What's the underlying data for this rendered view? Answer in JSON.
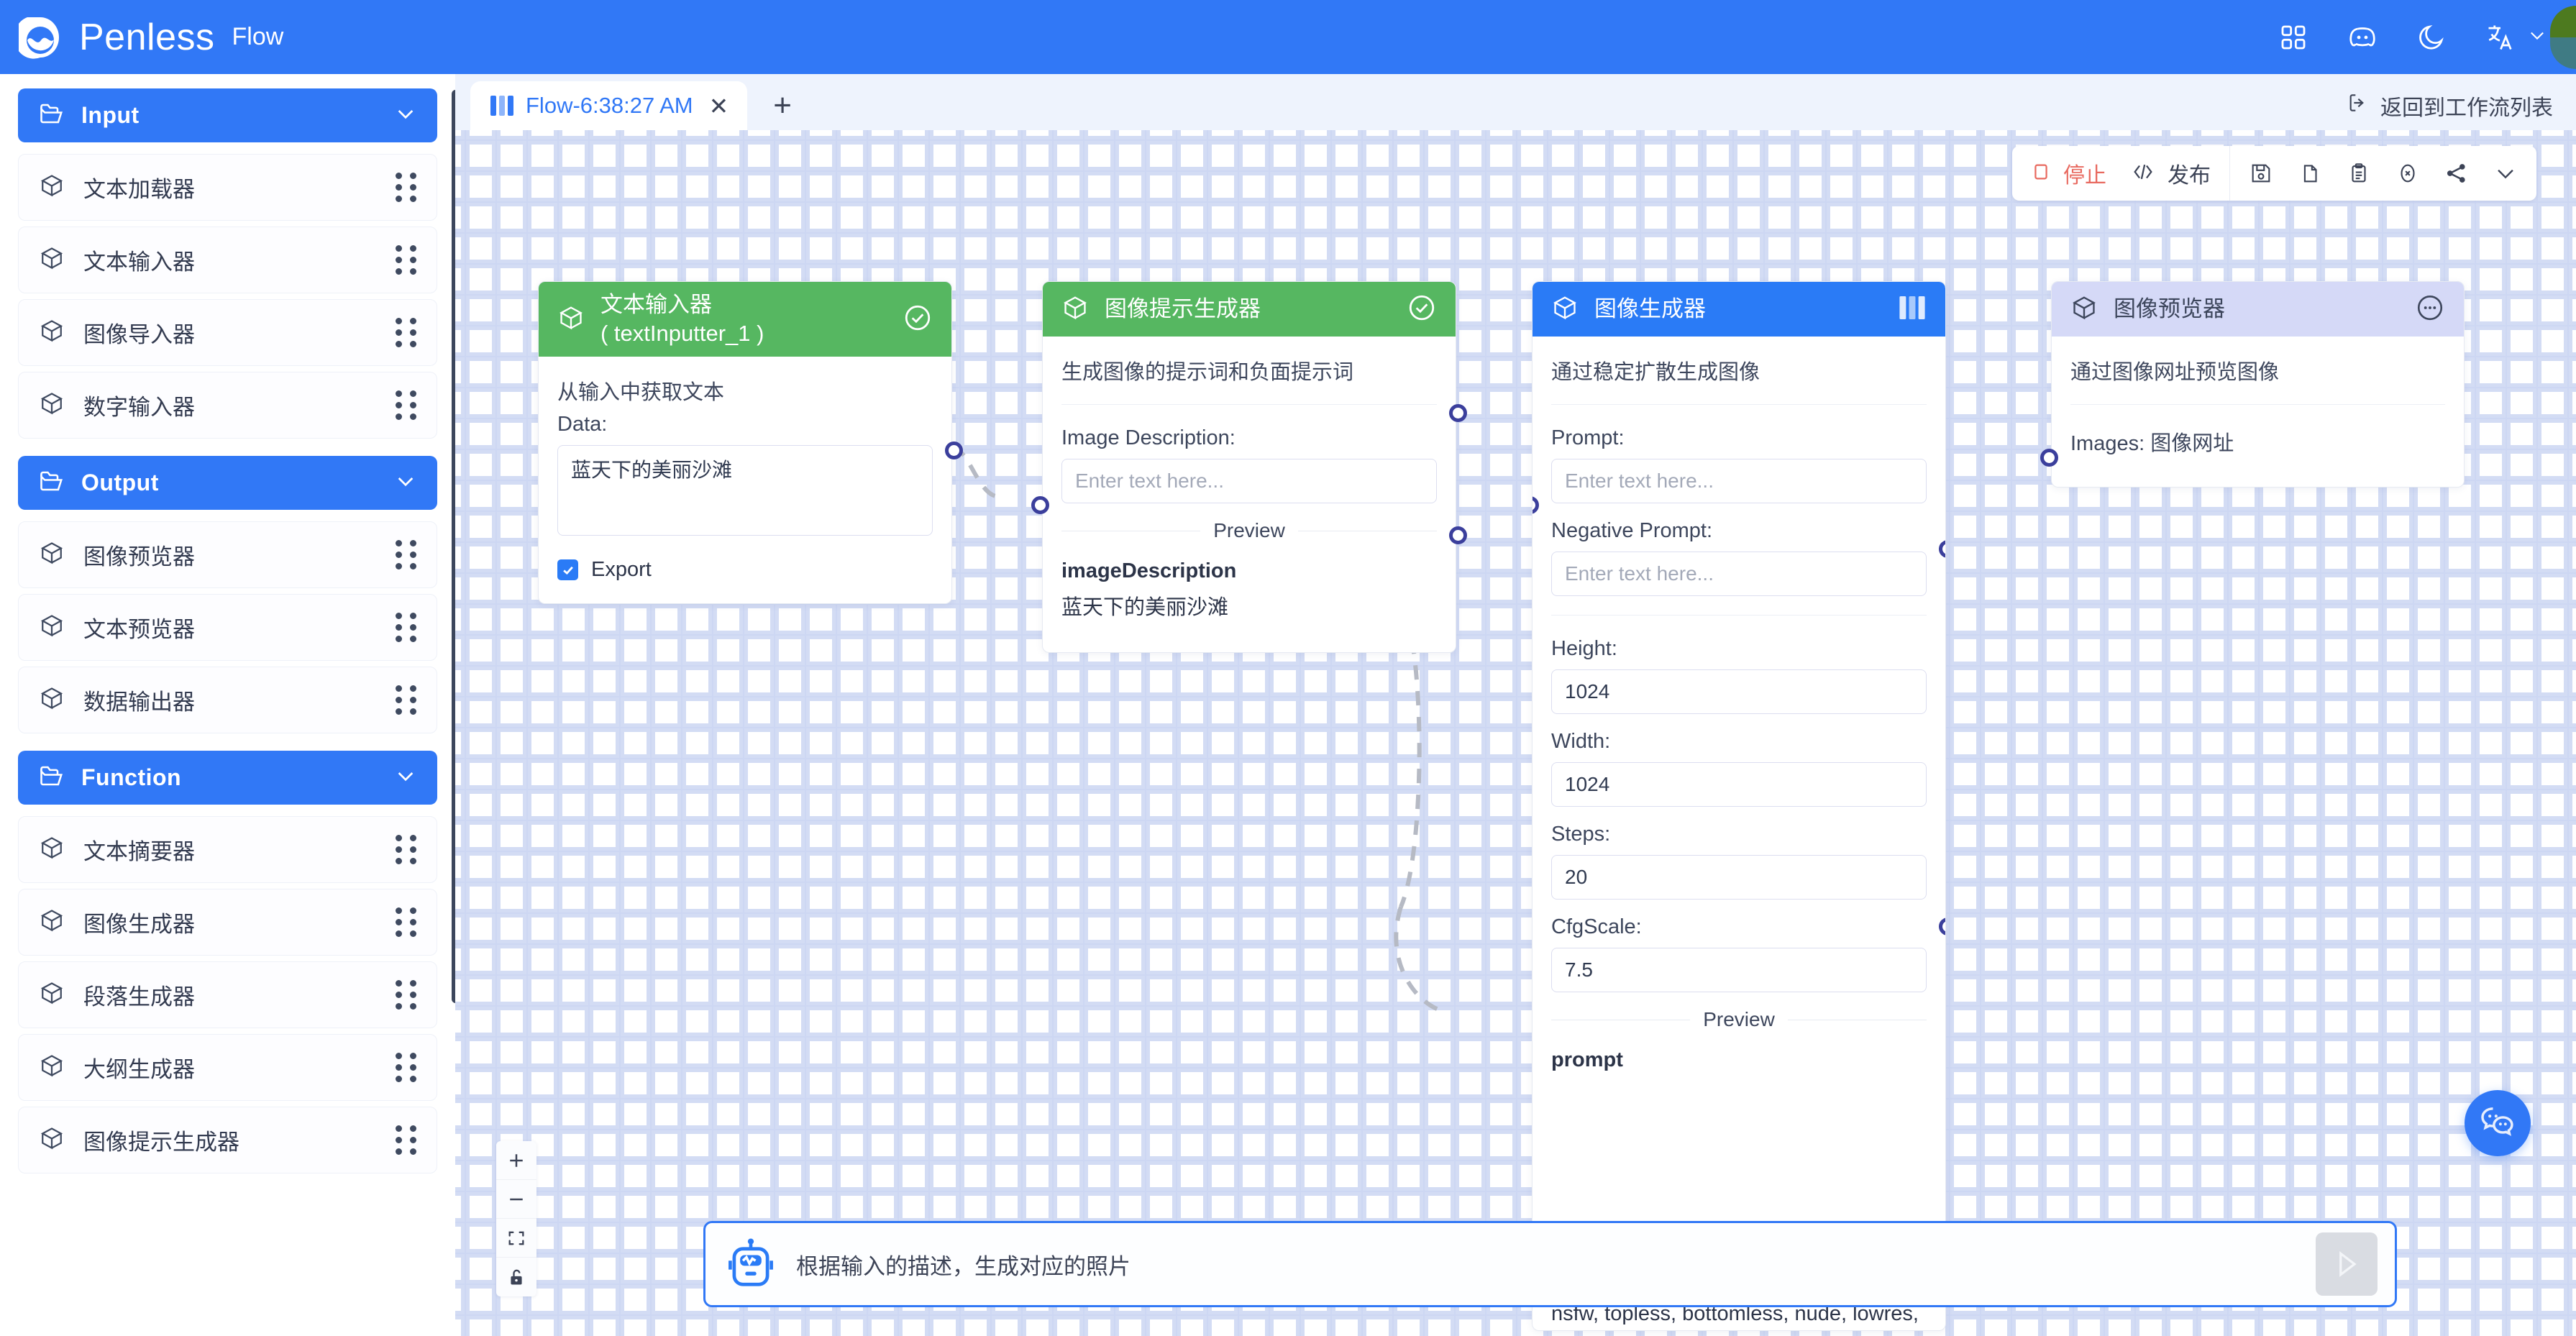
{
  "topbar": {
    "brand": "Penless",
    "product": "Flow",
    "icons": [
      "apps-grid-icon",
      "discord-icon",
      "moon-icon",
      "translate-icon",
      "chevron-down-icon"
    ]
  },
  "sidebar": {
    "groups": [
      {
        "label": "Input",
        "items": [
          {
            "label": "文本加载器"
          },
          {
            "label": "文本输入器"
          },
          {
            "label": "图像导入器"
          },
          {
            "label": "数字输入器"
          }
        ]
      },
      {
        "label": "Output",
        "items": [
          {
            "label": "图像预览器"
          },
          {
            "label": "文本预览器"
          },
          {
            "label": "数据输出器"
          }
        ]
      },
      {
        "label": "Function",
        "items": [
          {
            "label": "文本摘要器"
          },
          {
            "label": "图像生成器"
          },
          {
            "label": "段落生成器"
          },
          {
            "label": "大纲生成器"
          },
          {
            "label": "图像提示生成器"
          }
        ]
      }
    ]
  },
  "tabs": {
    "active_tab": "Flow-6:38:27 AM",
    "close_label": "✕",
    "new_tab_label": "+",
    "back_to_list": "返回到工作流列表"
  },
  "toolbar": {
    "stop_label": "停止",
    "publish_label": "发布",
    "icons": [
      "save-icon",
      "copy-icon",
      "paste-icon",
      "clear-icon",
      "share-icon",
      "chevron-down-icon"
    ]
  },
  "nodes": [
    {
      "title_line1": "文本输入器",
      "title_line2": "( textInputter_1 )",
      "desc": "从输入中获取文本",
      "data_label": "Data:",
      "data_value": "蓝天下的美丽沙滩",
      "export_label": "Export",
      "header_color": "#56b761"
    },
    {
      "title": "图像提示生成器",
      "desc": "生成图像的提示词和负面提示词",
      "field_label": "Image Description:",
      "field_placeholder": "Enter text here...",
      "field_value": "",
      "preview_label": "Preview",
      "preview_key": "imageDescription",
      "preview_value": "蓝天下的美丽沙滩",
      "header_color": "#56b761"
    },
    {
      "title": "图像生成器",
      "desc": "通过稳定扩散生成图像",
      "prompt_label": "Prompt:",
      "prompt_placeholder": "Enter text here...",
      "negative_label": "Negative Prompt:",
      "negative_placeholder": "Enter text here...",
      "height_label": "Height:",
      "height_value": "1024",
      "width_label": "Width:",
      "width_value": "1024",
      "steps_label": "Steps:",
      "steps_value": "20",
      "cfg_label": "CfgScale:",
      "cfg_value": "7.5",
      "preview_label": "Preview",
      "preview_key": "prompt",
      "header_color": "#2a7bf6"
    },
    {
      "title": "图像预览器",
      "desc": "通过图像网址预览图像",
      "images_label": "Images: 图像网址",
      "header_color": "#d5d9f7"
    }
  ],
  "overflow_text": "nsfw, topless, bottomless, nude, lowres,",
  "chat": {
    "placeholder": "根据输入的描述，生成对应的照片",
    "send_icon": "send-icon",
    "bot_icon": "robot-icon"
  },
  "zoom_controls": [
    {
      "icon": "zoom-in-icon",
      "label": "+"
    },
    {
      "icon": "zoom-out-icon",
      "label": "−"
    },
    {
      "icon": "fit-view-icon",
      "label": ""
    },
    {
      "icon": "lock-open-icon",
      "label": ""
    }
  ],
  "fab": {
    "icon": "chat-bubbles-icon"
  },
  "colors": {
    "brand_blue": "#3178f6",
    "node_green": "#56b761",
    "node_blue": "#2a7bf6",
    "node_lavender": "#d5d9f7",
    "stop_red": "#e8695f",
    "port_navy": "#3b3f9c"
  }
}
